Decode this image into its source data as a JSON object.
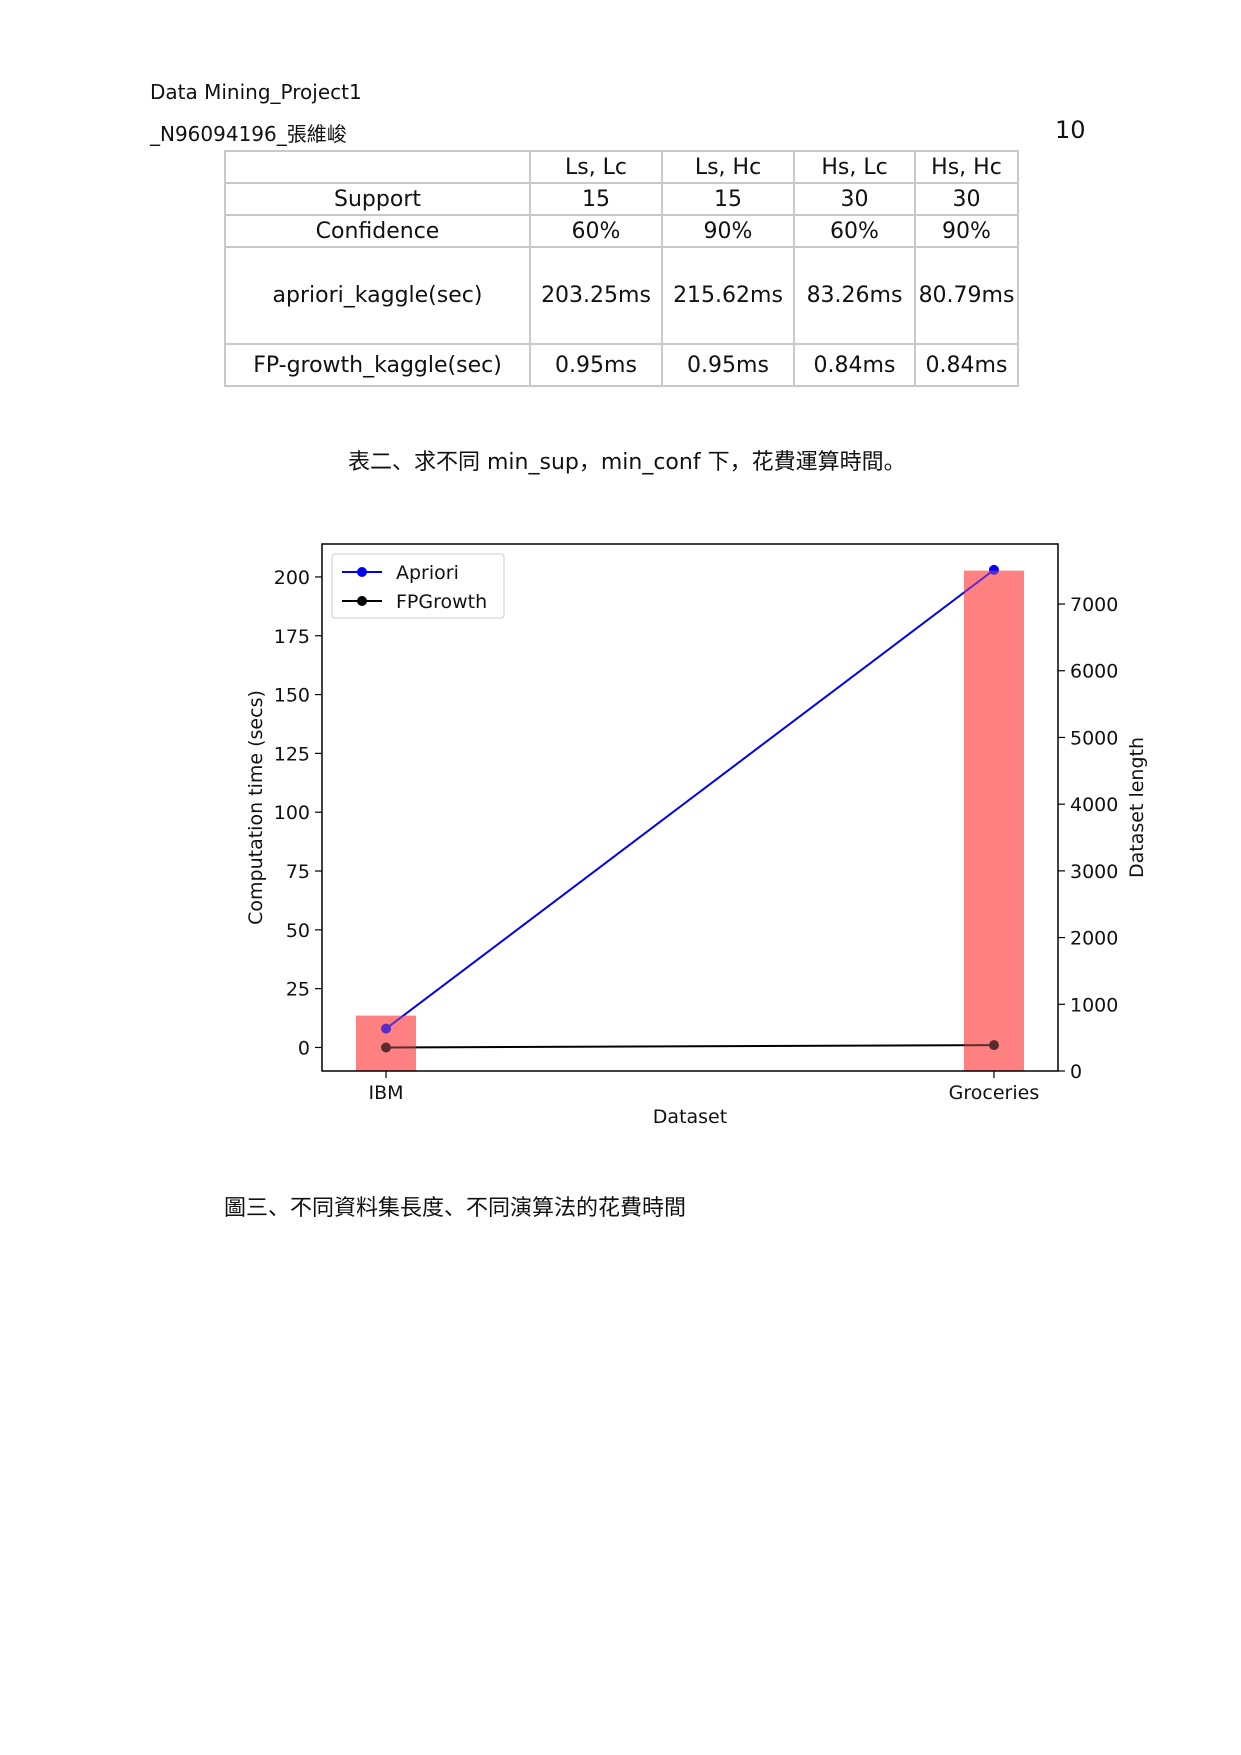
{
  "header": {
    "line1": "Data Mining_Project1",
    "line2": "_N96094196_張維峻",
    "page_number": "10"
  },
  "table": {
    "columns": [
      "",
      "Ls, Lc",
      "Ls, Hc",
      "Hs, Lc",
      "Hs, Hc"
    ],
    "rows": [
      [
        "Support",
        "15",
        "15",
        "30",
        "30"
      ],
      [
        "Confidence",
        "60%",
        "90%",
        "60%",
        "90%"
      ],
      [
        "apriori_kaggle(sec)",
        "203.25ms",
        "215.62ms",
        "83.26ms",
        "80.79ms"
      ],
      [
        "FP-growth_kaggle(sec)",
        "0.95ms",
        "0.95ms",
        "0.84ms",
        "0.84ms"
      ]
    ],
    "caption": "表二、求不同 min_sup，min_conf 下，花費運算時間。"
  },
  "figure_caption": "圖三、不同資料集長度、不同演算法的花費時間",
  "chart_data": {
    "type": "line",
    "categories": [
      "IBM",
      "Groceries"
    ],
    "xlabel": "Dataset",
    "ylabel": "Computation time (secs)",
    "y2label": "Dataset length",
    "ylim": [
      -10,
      214
    ],
    "y2lim": [
      0,
      7900
    ],
    "yticks": [
      0,
      25,
      50,
      75,
      100,
      125,
      150,
      175,
      200
    ],
    "y2ticks": [
      0,
      1000,
      2000,
      3000,
      4000,
      5000,
      6000,
      7000
    ],
    "series": [
      {
        "name": "Apriori",
        "kind": "line",
        "axis": "left",
        "color": "#0000ee",
        "values": [
          8,
          203
        ]
      },
      {
        "name": "FPGrowth",
        "kind": "line",
        "axis": "left",
        "color": "#000000",
        "values": [
          0,
          1
        ]
      },
      {
        "name": "Dataset length",
        "kind": "bar",
        "axis": "right",
        "color": "#ff8080",
        "values": [
          830,
          7500
        ]
      }
    ],
    "legend": "top-left",
    "grid": false
  }
}
